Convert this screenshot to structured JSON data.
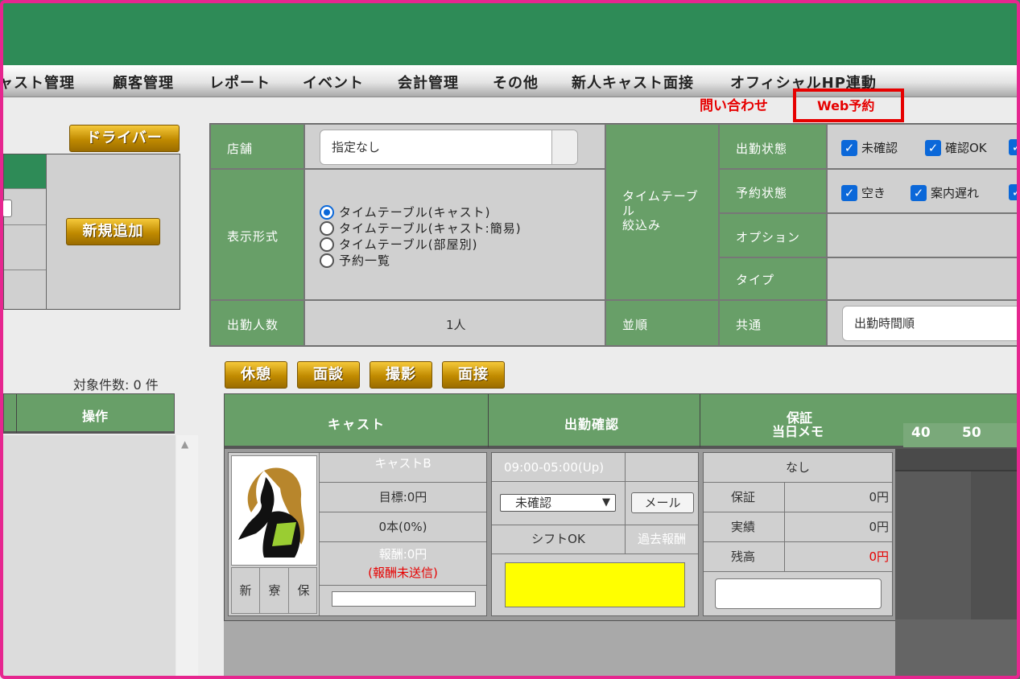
{
  "nav": {
    "items": [
      "ャスト管理",
      "顧客管理",
      "レポート",
      "イベント",
      "会計管理",
      "その他",
      "新人キャスト面接",
      "オフィシャルHP連動"
    ]
  },
  "sublinks": {
    "inquiry": "問い合わせ",
    "web_reservation": "Web予約"
  },
  "left": {
    "driver_button": "ドライバー",
    "add_button": "新規追加",
    "count_label": "対象件数: 0 件",
    "operation_header": "操作"
  },
  "filters": {
    "store_label": "店舗",
    "store_value": "指定なし",
    "display_label": "表示形式",
    "display_options": [
      "タイムテーブル(キャスト)",
      "タイムテーブル(キャスト:簡易)",
      "タイムテーブル(部屋別)",
      "予約一覧"
    ],
    "attendance_count_label": "出勤人数",
    "attendance_count_value": "1人",
    "timetable_filter_label": "タイムテーブル\n絞込み",
    "sort_label": "並順",
    "attendance_status_label": "出勤状態",
    "attendance_status_options": [
      "未確認",
      "確認OK"
    ],
    "reservation_status_label": "予約状態",
    "reservation_status_options": [
      "空き",
      "案内遅れ"
    ],
    "option_label": "オプション",
    "type_label": "タイプ",
    "common_label": "共通",
    "sort_value": "出勤時間順"
  },
  "actions": [
    "休憩",
    "面談",
    "撮影",
    "面接"
  ],
  "table": {
    "headers": {
      "cast": "キャスト",
      "attendance_check": "出勤確認",
      "guarantee": "保証",
      "memo": "当日メモ"
    },
    "ticks": [
      "40",
      "50"
    ]
  },
  "cast_row": {
    "name": "キャストB",
    "target": "目標:0円",
    "count": "0本(0%)",
    "reward": "報酬:0円",
    "reward_unsent": "(報酬未送信)",
    "small_buttons": [
      "新",
      "寮",
      "保"
    ],
    "shift_time": "09:00-05:00(Up)",
    "status_select": "未確認",
    "mail_button": "メール",
    "shift_ok": "シフトOK",
    "past_reward": "過去報酬",
    "guarantee_none": "なし",
    "guarantee_rows": [
      {
        "label": "保証",
        "value": "0円"
      },
      {
        "label": "実績",
        "value": "0円"
      },
      {
        "label": "残高",
        "value": "0円"
      }
    ]
  },
  "colors": {
    "green_header": "#2e8b57",
    "cell_green": "#689f68",
    "highlight_yellow": "#ffff00",
    "alert_red": "#e60000",
    "frame_pink": "#e6268f"
  }
}
